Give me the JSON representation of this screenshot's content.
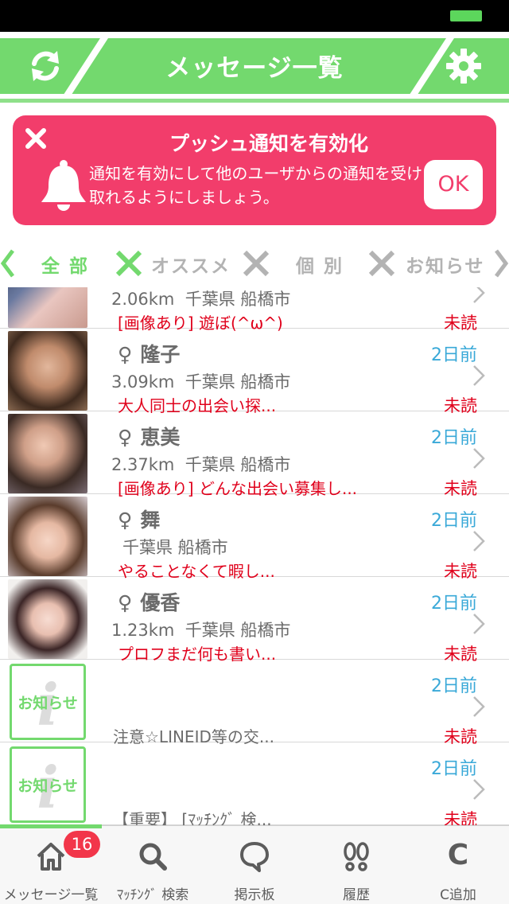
{
  "header": {
    "title": "メッセージ一覧"
  },
  "push": {
    "title": "プッシュ通知を有効化",
    "body": "通知を有効にして他のユーザからの通知を受け取れるようにしましょう。",
    "ok_label": "OK"
  },
  "tabs": [
    {
      "label": "全 部",
      "active": true
    },
    {
      "label": "オススメ",
      "active": false
    },
    {
      "label": "個 別",
      "active": false
    },
    {
      "label": "お知らせ",
      "active": false
    }
  ],
  "messages": [
    {
      "name": "",
      "distance": "2.06km",
      "location": "千葉県 船橋市",
      "preview": "[画像あり] 遊ぼ(^ω^)",
      "date": "",
      "status": "未読"
    },
    {
      "name": "隆子",
      "sex": "♀",
      "distance": "3.09km",
      "location": "千葉県 船橋市",
      "preview": "大人同士の出会い探...",
      "date": "2日前",
      "status": "未読"
    },
    {
      "name": "恵美",
      "sex": "♀",
      "distance": "2.37km",
      "location": "千葉県 船橋市",
      "preview": "[画像あり] どんな出会い募集し...",
      "date": "2日前",
      "status": "未読"
    },
    {
      "name": "舞",
      "sex": "♀",
      "distance": "",
      "location": "千葉県 船橋市",
      "preview": "やることなくて暇し...",
      "date": "2日前",
      "status": "未読"
    },
    {
      "name": "優香",
      "sex": "♀",
      "distance": "1.23km",
      "location": "千葉県 船橋市",
      "preview": "プロフまだ何も書い...",
      "date": "2日前",
      "status": "未読"
    }
  ],
  "notices": [
    {
      "badge": "お知らせ",
      "preview": "注意☆LINEID等の交...",
      "date": "2日前",
      "status": "未読"
    },
    {
      "badge": "お知らせ",
      "preview": "【重要】 [ﾏｯﾁﾝｸﾞ 検...",
      "date": "2日前",
      "status": "未読"
    }
  ],
  "nav": [
    {
      "label": "メッセージ一覧",
      "icon": "home-icon",
      "badge": "16",
      "active": true
    },
    {
      "label": "ﾏｯﾁﾝｸﾞ 検索",
      "icon": "search-icon"
    },
    {
      "label": "掲示板",
      "icon": "speech-bubble-icon"
    },
    {
      "label": "履歴",
      "icon": "footprints-icon"
    },
    {
      "label": "C追加",
      "icon": "c-icon",
      "glyph": "C"
    }
  ],
  "colors": {
    "accent": "#73d96e",
    "banner": "#f23d6b",
    "date": "#3aa9d8",
    "unread": "#e0001b"
  }
}
